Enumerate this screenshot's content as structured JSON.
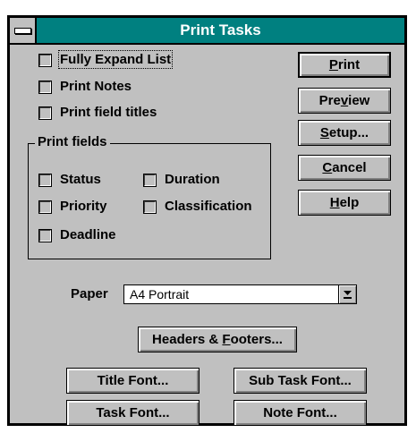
{
  "window": {
    "title": "Print Tasks"
  },
  "options": {
    "fully_expand_list": "Fully Expand List",
    "print_notes": "Print Notes",
    "print_field_titles": "Print field titles"
  },
  "print_fields": {
    "legend": "Print fields",
    "status": "Status",
    "duration": "Duration",
    "priority": "Priority",
    "classification": "Classification",
    "deadline": "Deadline"
  },
  "buttons": {
    "print": {
      "pre": "",
      "key": "P",
      "post": "rint"
    },
    "preview": {
      "pre": "Pre",
      "key": "v",
      "post": "iew"
    },
    "setup": {
      "pre": "",
      "key": "S",
      "post": "etup..."
    },
    "cancel": {
      "pre": "",
      "key": "C",
      "post": "ancel"
    },
    "help": {
      "pre": "",
      "key": "H",
      "post": "elp"
    },
    "headers_footers": {
      "pre": "Headers & ",
      "key": "F",
      "post": "ooters..."
    },
    "title_font": "Title Font...",
    "sub_task_font": "Sub Task Font...",
    "task_font": "Task Font...",
    "note_font": "Note Font..."
  },
  "paper": {
    "label": "Paper",
    "value": "A4  Portrait"
  },
  "colors": {
    "titlebar": "#008080",
    "dialog": "#c0c0c0"
  },
  "icons": {
    "system_menu": "system-menu-icon",
    "dropdown": "dropdown-arrow-icon"
  }
}
